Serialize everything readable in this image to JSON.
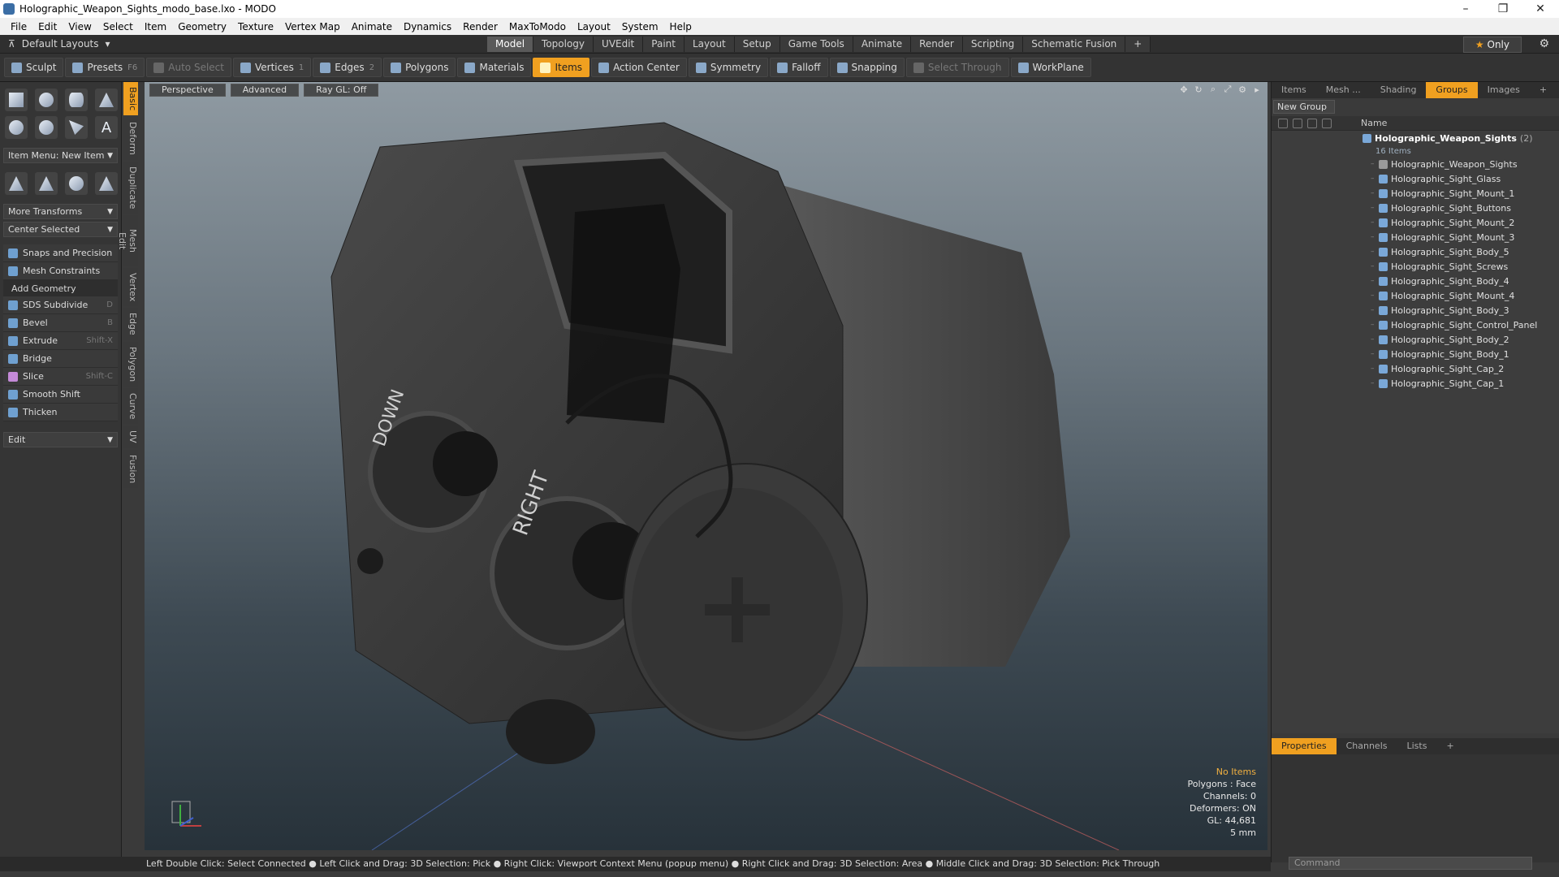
{
  "window": {
    "title": "Holographic_Weapon_Sights_modo_base.lxo - MODO",
    "minimize": "–",
    "maximize": "❐",
    "close": "✕"
  },
  "menubar": [
    "File",
    "Edit",
    "View",
    "Select",
    "Item",
    "Geometry",
    "Texture",
    "Vertex Map",
    "Animate",
    "Dynamics",
    "Render",
    "MaxToModo",
    "Layout",
    "System",
    "Help"
  ],
  "layoutbar": {
    "layouts_label": "Default Layouts",
    "tabs": [
      "Model",
      "Topology",
      "UVEdit",
      "Paint",
      "Layout",
      "Setup",
      "Game Tools",
      "Animate",
      "Render",
      "Scripting",
      "Schematic Fusion"
    ],
    "active_tab": "Model",
    "add_tab": "+",
    "only_label": "Only"
  },
  "toolbar": {
    "sculpt": "Sculpt",
    "presets": "Presets",
    "presets_key": "F6",
    "auto_select": "Auto Select",
    "vertices": "Vertices",
    "vertices_key": "1",
    "edges": "Edges",
    "edges_key": "2",
    "polygons": "Polygons",
    "materials": "Materials",
    "items": "Items",
    "action_center": "Action Center",
    "symmetry": "Symmetry",
    "falloff": "Falloff",
    "snapping": "Snapping",
    "select_through": "Select Through",
    "workplane": "WorkPlane"
  },
  "left_panel": {
    "item_menu": "Item Menu: New Item",
    "more_transforms": "More Transforms",
    "center_selected": "Center Selected",
    "snaps": "Snaps and Precision",
    "mesh_constraints": "Mesh Constraints",
    "add_geometry": "Add Geometry",
    "tools": [
      {
        "label": "SDS Subdivide",
        "key": "D"
      },
      {
        "label": "Bevel",
        "key": "B"
      },
      {
        "label": "Extrude",
        "key": "Shift-X"
      },
      {
        "label": "Bridge",
        "key": ""
      },
      {
        "label": "Slice",
        "key": "Shift-C"
      },
      {
        "label": "Smooth Shift",
        "key": ""
      },
      {
        "label": "Thicken",
        "key": ""
      }
    ],
    "edit": "Edit",
    "vertical_tabs": [
      "Basic",
      "Deform",
      "Duplicate",
      "Mesh Edit",
      "Vertex",
      "Edge",
      "Polygon",
      "Curve",
      "UV",
      "Fusion"
    ]
  },
  "viewport": {
    "perspective": "Perspective",
    "advanced": "Advanced",
    "raygl": "Ray GL: Off",
    "info": {
      "no_items": "No Items",
      "polygons": "Polygons : Face",
      "channels": "Channels: 0",
      "deformers": "Deformers: ON",
      "gl": "GL: 44,681",
      "scale": "5 mm"
    },
    "model_labels": {
      "down": "DOWN",
      "right": "RIGHT"
    }
  },
  "right_panel": {
    "tabs": [
      "Items",
      "Mesh ...",
      "Shading",
      "Groups",
      "Images"
    ],
    "active_tab": "Groups",
    "new_group": "New Group",
    "name_col": "Name",
    "root": {
      "label": "Holographic_Weapon_Sights",
      "count": "(2)",
      "sub": "16 Items"
    },
    "items": [
      "Holographic_Weapon_Sights",
      "Holographic_Sight_Glass",
      "Holographic_Sight_Mount_1",
      "Holographic_Sight_Buttons",
      "Holographic_Sight_Mount_2",
      "Holographic_Sight_Mount_3",
      "Holographic_Sight_Body_5",
      "Holographic_Sight_Screws",
      "Holographic_Sight_Body_4",
      "Holographic_Sight_Mount_4",
      "Holographic_Sight_Body_3",
      "Holographic_Sight_Control_Panel",
      "Holographic_Sight_Body_2",
      "Holographic_Sight_Body_1",
      "Holographic_Sight_Cap_2",
      "Holographic_Sight_Cap_1"
    ],
    "bottom_tabs": [
      "Properties",
      "Channels",
      "Lists"
    ],
    "bottom_active": "Properties"
  },
  "statusbar": {
    "text": "Left Double Click: Select Connected ● Left Click and Drag: 3D Selection: Pick ● Right Click: Viewport Context Menu (popup menu) ● Right Click and Drag: 3D Selection: Area ● Middle Click and Drag: 3D Selection: Pick Through",
    "command_placeholder": "Command"
  },
  "colors": {
    "accent": "#f0a020",
    "panel": "#3a3a3a",
    "dark": "#2a2a2a"
  }
}
